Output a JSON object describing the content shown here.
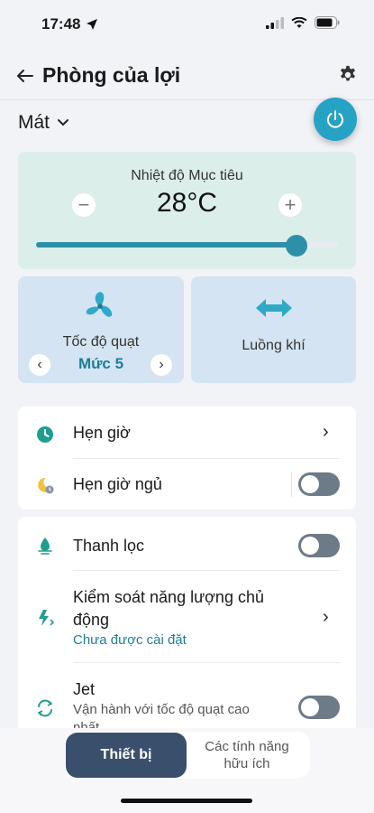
{
  "status": {
    "time": "17:48"
  },
  "header": {
    "title": "Phòng của lợi"
  },
  "mode": {
    "label": "Mát"
  },
  "temperature": {
    "label": "Nhiệt độ Mục tiêu",
    "value": "28°C",
    "minus": "−",
    "plus": "+",
    "slider_fraction": 0.86
  },
  "fan": {
    "label": "Tốc độ quạt",
    "level": "Mức 5",
    "prev": "‹",
    "next": "›"
  },
  "airflow": {
    "label": "Luồng khí"
  },
  "list1": {
    "timer": {
      "label": "Hẹn giờ",
      "chevron": "›"
    },
    "sleep_timer": {
      "label": "Hẹn giờ ngủ",
      "on": false
    }
  },
  "list2": {
    "purify": {
      "label": "Thanh lọc",
      "on": false
    },
    "energy": {
      "label_line1": "Kiểm soát năng lượng chủ",
      "label_line2": "động",
      "sub": "Chưa được cài đặt",
      "chevron": "›"
    },
    "jet": {
      "label": "Jet",
      "sub_line1": "Vận hành với tốc độ quạt cao",
      "sub_line2": "nhất",
      "on": false
    }
  },
  "bottom_nav": {
    "device": "Thiết bị",
    "features_line1": "Các tính năng",
    "features_line2": "hữu ích"
  },
  "colors": {
    "accent": "#2e90a8",
    "power": "#26a2c4",
    "temp_card": "#dbeee9",
    "fan_card": "#d4e4f3",
    "nav_active": "#3a4f6b",
    "toggle_off": "#6d7a88"
  },
  "icons": {
    "back": "arrow-left-icon",
    "settings": "gear-icon",
    "mode": "chevron-down-icon",
    "power": "power-icon",
    "fan": "fan-icon",
    "airflow": "double-arrow-icon",
    "timer": "clock-icon",
    "sleep": "moon-clock-icon",
    "purify": "purify-icon",
    "energy": "energy-icon",
    "jet": "jet-icon"
  }
}
